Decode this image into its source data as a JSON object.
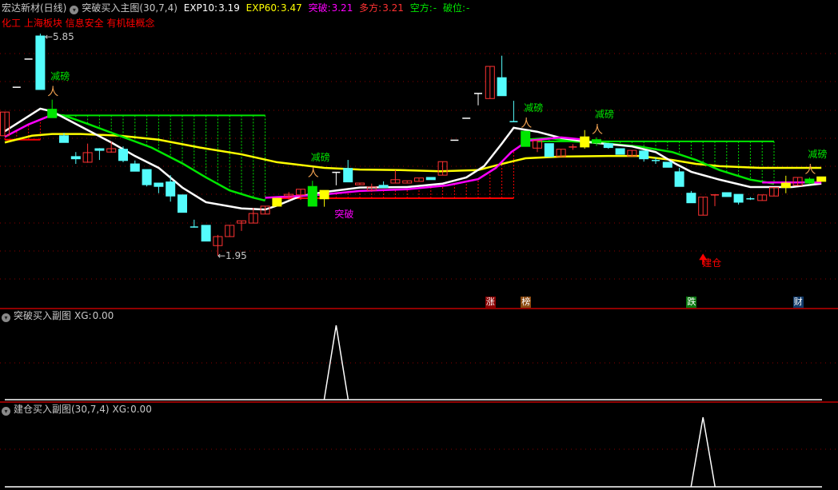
{
  "header": {
    "stock": "宏达新材(日线)",
    "indicator": "突破买入主图(30,7,4)",
    "exp10_label": "EXP10:",
    "exp10": "3.19",
    "exp60_label": "EXP60:",
    "exp60": "3.47",
    "tupo_label": "突破:",
    "tupo": "3.21",
    "duofang_label": "多方:",
    "duofang": "3.21",
    "kongfang_label": "空方:",
    "kongfang": "-",
    "powei_label": "破位:",
    "powei": "-"
  },
  "concepts": "化工 上海板块 信息安全 有机硅概念",
  "price_labels": {
    "high": "←5.85",
    "low": "←1.95",
    "high_value": 5.85,
    "low_value": 1.95
  },
  "markers": {
    "reduce_label": "减磅",
    "breakout_label": "突破",
    "build_label": "建仓",
    "reduce_indexes": [
      4,
      26,
      44,
      50,
      68
    ],
    "breakout_index": 28,
    "build_index": 59
  },
  "badges": [
    {
      "label": "涨",
      "color": "#8b0000",
      "index": 41
    },
    {
      "label": "榜",
      "color": "#8b4a10",
      "index": 44
    },
    {
      "label": "跌",
      "color": "#0a7a10",
      "index": 58
    },
    {
      "label": "财",
      "color": "#103a6a",
      "index": 67
    }
  ],
  "sub1": {
    "title": "突破买入副图",
    "xg_label": "XG:",
    "xg": "0.00",
    "signal_index": 28
  },
  "sub2": {
    "title": "建仓买入副图(30,7,4)",
    "xg_label": "XG:",
    "xg": "0.00",
    "signal_index": 59
  },
  "colors": {
    "up": "#ff3232",
    "down": "#54fcfc",
    "grid": "#8b0000",
    "white": "#ffffff",
    "magenta": "#ff00ff",
    "yellow": "#ffff00",
    "green": "#00e600",
    "red": "#ff0000"
  },
  "candles": [
    [
      4.08,
      4.5,
      4.5,
      4.08,
      "r"
    ],
    [
      4.94,
      4.94,
      4.94,
      4.94,
      "w"
    ],
    [
      5.44,
      5.44,
      5.44,
      5.44,
      "w"
    ],
    [
      5.85,
      4.9,
      5.89,
      4.9,
      "c"
    ],
    [
      4.55,
      4.4,
      4.72,
      4.4,
      "g"
    ],
    [
      4.08,
      3.96,
      4.13,
      3.96,
      "c"
    ],
    [
      3.71,
      3.67,
      3.79,
      3.58,
      "c"
    ],
    [
      3.61,
      3.78,
      3.94,
      3.6,
      "r"
    ],
    [
      3.85,
      3.82,
      3.86,
      3.65,
      "c"
    ],
    [
      3.79,
      3.85,
      3.98,
      3.78,
      "r"
    ],
    [
      3.84,
      3.64,
      3.89,
      3.61,
      "c"
    ],
    [
      3.58,
      3.45,
      3.64,
      3.45,
      "c"
    ],
    [
      3.48,
      3.21,
      3.48,
      3.18,
      "c"
    ],
    [
      3.24,
      3.18,
      3.24,
      3.06,
      "c"
    ],
    [
      3.26,
      3.01,
      3.38,
      2.91,
      "c"
    ],
    [
      3.03,
      2.72,
      3.03,
      2.72,
      "c"
    ],
    [
      2.46,
      2.45,
      2.59,
      2.45,
      "c"
    ],
    [
      2.49,
      2.21,
      2.49,
      2.21,
      "c"
    ],
    [
      2.13,
      2.29,
      2.32,
      1.95,
      "r"
    ],
    [
      2.29,
      2.49,
      2.49,
      2.29,
      "r"
    ],
    [
      2.53,
      2.57,
      2.57,
      2.39,
      "r"
    ],
    [
      2.53,
      2.7,
      2.8,
      2.53,
      "r"
    ],
    [
      2.69,
      2.83,
      2.83,
      2.69,
      "r"
    ],
    [
      2.83,
      2.97,
      2.97,
      2.83,
      "y"
    ],
    [
      3.01,
      3.04,
      3.08,
      2.94,
      "r"
    ],
    [
      3.03,
      3.13,
      3.13,
      2.94,
      "r"
    ],
    [
      3.18,
      2.83,
      3.28,
      2.83,
      "g"
    ],
    [
      3.11,
      2.96,
      3.11,
      2.82,
      "y"
    ],
    [
      3.43,
      3.43,
      3.43,
      3.2,
      "w"
    ],
    [
      3.5,
      3.26,
      3.65,
      3.26,
      "c"
    ],
    [
      3.21,
      3.24,
      3.24,
      3.21,
      "r"
    ],
    [
      3.11,
      3.17,
      3.23,
      3.11,
      "r"
    ],
    [
      3.2,
      3.16,
      3.27,
      3.16,
      "c"
    ],
    [
      3.24,
      3.3,
      3.47,
      3.24,
      "r"
    ],
    [
      3.24,
      3.28,
      3.28,
      3.24,
      "r"
    ],
    [
      3.27,
      3.33,
      3.33,
      3.27,
      "r"
    ],
    [
      3.34,
      3.3,
      3.34,
      3.3,
      "c"
    ],
    [
      3.38,
      3.62,
      3.62,
      3.38,
      "r"
    ],
    [
      4.0,
      4.0,
      4.0,
      4.0,
      "w"
    ],
    [
      4.39,
      4.39,
      4.39,
      4.39,
      "w"
    ],
    [
      4.83,
      4.83,
      4.83,
      4.62,
      "w"
    ],
    [
      4.74,
      5.31,
      5.31,
      4.74,
      "r"
    ],
    [
      5.11,
      4.79,
      5.5,
      4.79,
      "c"
    ],
    [
      4.33,
      4.33,
      4.7,
      4.33,
      "c"
    ],
    [
      4.16,
      3.89,
      4.16,
      3.89,
      "g"
    ],
    [
      3.86,
      3.99,
      3.99,
      3.79,
      "r"
    ],
    [
      3.94,
      3.71,
      3.94,
      3.71,
      "c"
    ],
    [
      3.71,
      3.84,
      3.84,
      3.71,
      "r"
    ],
    [
      3.88,
      3.88,
      3.93,
      3.83,
      "r"
    ],
    [
      4.06,
      3.88,
      4.18,
      3.85,
      "y"
    ],
    [
      4.01,
      3.95,
      4.05,
      3.9,
      "g"
    ],
    [
      3.94,
      3.87,
      3.94,
      3.85,
      "c"
    ],
    [
      3.85,
      3.75,
      3.85,
      3.75,
      "c"
    ],
    [
      3.72,
      3.82,
      3.82,
      3.72,
      "r"
    ],
    [
      3.81,
      3.67,
      3.81,
      3.62,
      "c"
    ],
    [
      3.64,
      3.64,
      3.7,
      3.58,
      "c"
    ],
    [
      3.61,
      3.52,
      3.61,
      3.52,
      "c"
    ],
    [
      3.44,
      3.18,
      3.51,
      3.18,
      "c"
    ],
    [
      3.06,
      2.89,
      3.1,
      2.89,
      "c"
    ],
    [
      2.67,
      2.99,
      2.99,
      2.67,
      "r"
    ],
    [
      3.03,
      3.03,
      3.03,
      2.83,
      "r"
    ],
    [
      3.07,
      3.0,
      3.07,
      3.0,
      "c"
    ],
    [
      3.04,
      2.9,
      3.04,
      2.86,
      "c"
    ],
    [
      2.96,
      2.96,
      2.99,
      2.94,
      "c"
    ],
    [
      2.93,
      3.03,
      3.03,
      2.93,
      "r"
    ],
    [
      3.01,
      3.16,
      3.16,
      3.01,
      "r"
    ],
    [
      3.24,
      3.16,
      3.37,
      3.06,
      "y"
    ],
    [
      3.2,
      3.34,
      3.34,
      3.2,
      "r"
    ],
    [
      3.31,
      3.24,
      3.34,
      3.22,
      "g"
    ],
    [
      3.35,
      3.27,
      3.35,
      3.27,
      "y"
    ]
  ],
  "lines": {
    "exp10_white": [
      [
        0,
        4.16
      ],
      [
        3,
        4.56
      ],
      [
        4,
        4.51
      ],
      [
        7,
        4.18
      ],
      [
        9,
        3.96
      ],
      [
        11,
        3.72
      ],
      [
        13,
        3.51
      ],
      [
        15,
        3.16
      ],
      [
        17,
        2.9
      ],
      [
        20,
        2.79
      ],
      [
        22,
        2.77
      ],
      [
        23,
        2.84
      ],
      [
        25,
        3.01
      ],
      [
        27,
        3.08
      ],
      [
        30,
        3.16
      ],
      [
        34,
        3.17
      ],
      [
        37,
        3.23
      ],
      [
        39,
        3.34
      ],
      [
        40.5,
        3.54
      ],
      [
        42,
        3.94
      ],
      [
        43,
        4.22
      ],
      [
        45,
        4.15
      ],
      [
        47,
        4.04
      ],
      [
        49.6,
        3.96
      ],
      [
        53,
        3.89
      ],
      [
        55,
        3.79
      ],
      [
        56.7,
        3.58
      ],
      [
        58,
        3.44
      ],
      [
        60.4,
        3.3
      ],
      [
        63,
        3.17
      ],
      [
        66.5,
        3.17
      ],
      [
        69,
        3.23
      ]
    ],
    "exp60_yellow": [
      [
        0,
        3.96
      ],
      [
        2.3,
        4.08
      ],
      [
        4,
        4.11
      ],
      [
        6.4,
        4.11
      ],
      [
        9.7,
        4.08
      ],
      [
        13,
        4.01
      ],
      [
        16.5,
        3.87
      ],
      [
        20,
        3.75
      ],
      [
        23,
        3.61
      ],
      [
        27,
        3.51
      ],
      [
        30,
        3.48
      ],
      [
        33.4,
        3.47
      ],
      [
        36.8,
        3.45
      ],
      [
        40,
        3.47
      ],
      [
        42,
        3.58
      ],
      [
        44,
        3.68
      ],
      [
        47,
        3.71
      ],
      [
        51,
        3.72
      ],
      [
        53.6,
        3.72
      ],
      [
        56.4,
        3.65
      ],
      [
        58.4,
        3.58
      ],
      [
        60.4,
        3.54
      ],
      [
        63.8,
        3.51
      ],
      [
        67,
        3.51
      ],
      [
        69,
        3.51
      ]
    ],
    "tupo_magenta": [
      [
        [
          0,
          4.06
        ],
        [
          2,
          4.28
        ],
        [
          4,
          4.45
        ]
      ],
      [
        [
          22,
          2.98
        ],
        [
          26.6,
          3.03
        ],
        [
          30,
          3.1
        ],
        [
          34,
          3.13
        ],
        [
          37.4,
          3.2
        ],
        [
          40,
          3.31
        ],
        [
          41.5,
          3.51
        ],
        [
          42.8,
          3.79
        ],
        [
          44.2,
          3.99
        ],
        [
          47,
          4.05
        ],
        [
          49,
          4.01
        ]
      ],
      [
        [
          64,
          3.25
        ],
        [
          69,
          3.25
        ]
      ]
    ],
    "kongfang_green": [
      [
        [
          4,
          4.46
        ],
        [
          5,
          4.44
        ],
        [
          7,
          4.29
        ],
        [
          9.7,
          4.08
        ],
        [
          12.4,
          3.87
        ],
        [
          15,
          3.59
        ],
        [
          17,
          3.34
        ],
        [
          19,
          3.11
        ],
        [
          21,
          2.98
        ],
        [
          22,
          2.93
        ]
      ],
      [
        [
          44,
          4.01
        ],
        [
          46,
          4.04
        ],
        [
          48,
          3.98
        ],
        [
          51,
          3.94
        ],
        [
          53.6,
          3.89
        ],
        [
          56.4,
          3.79
        ],
        [
          58.4,
          3.65
        ],
        [
          60.4,
          3.47
        ],
        [
          63,
          3.3
        ],
        [
          65,
          3.23
        ]
      ]
    ]
  },
  "zones": {
    "green": [
      {
        "from": 4,
        "to": 22,
        "level": 4.44,
        "curve": 0
      },
      {
        "from": 45,
        "to": 65,
        "level": 3.98,
        "curve": 1
      }
    ],
    "red": [
      {
        "from": 23,
        "to": 43,
        "level": 2.97,
        "curve": 1
      },
      {
        "from": 0,
        "to": 3,
        "level": 4.01,
        "curve": 0
      }
    ]
  }
}
